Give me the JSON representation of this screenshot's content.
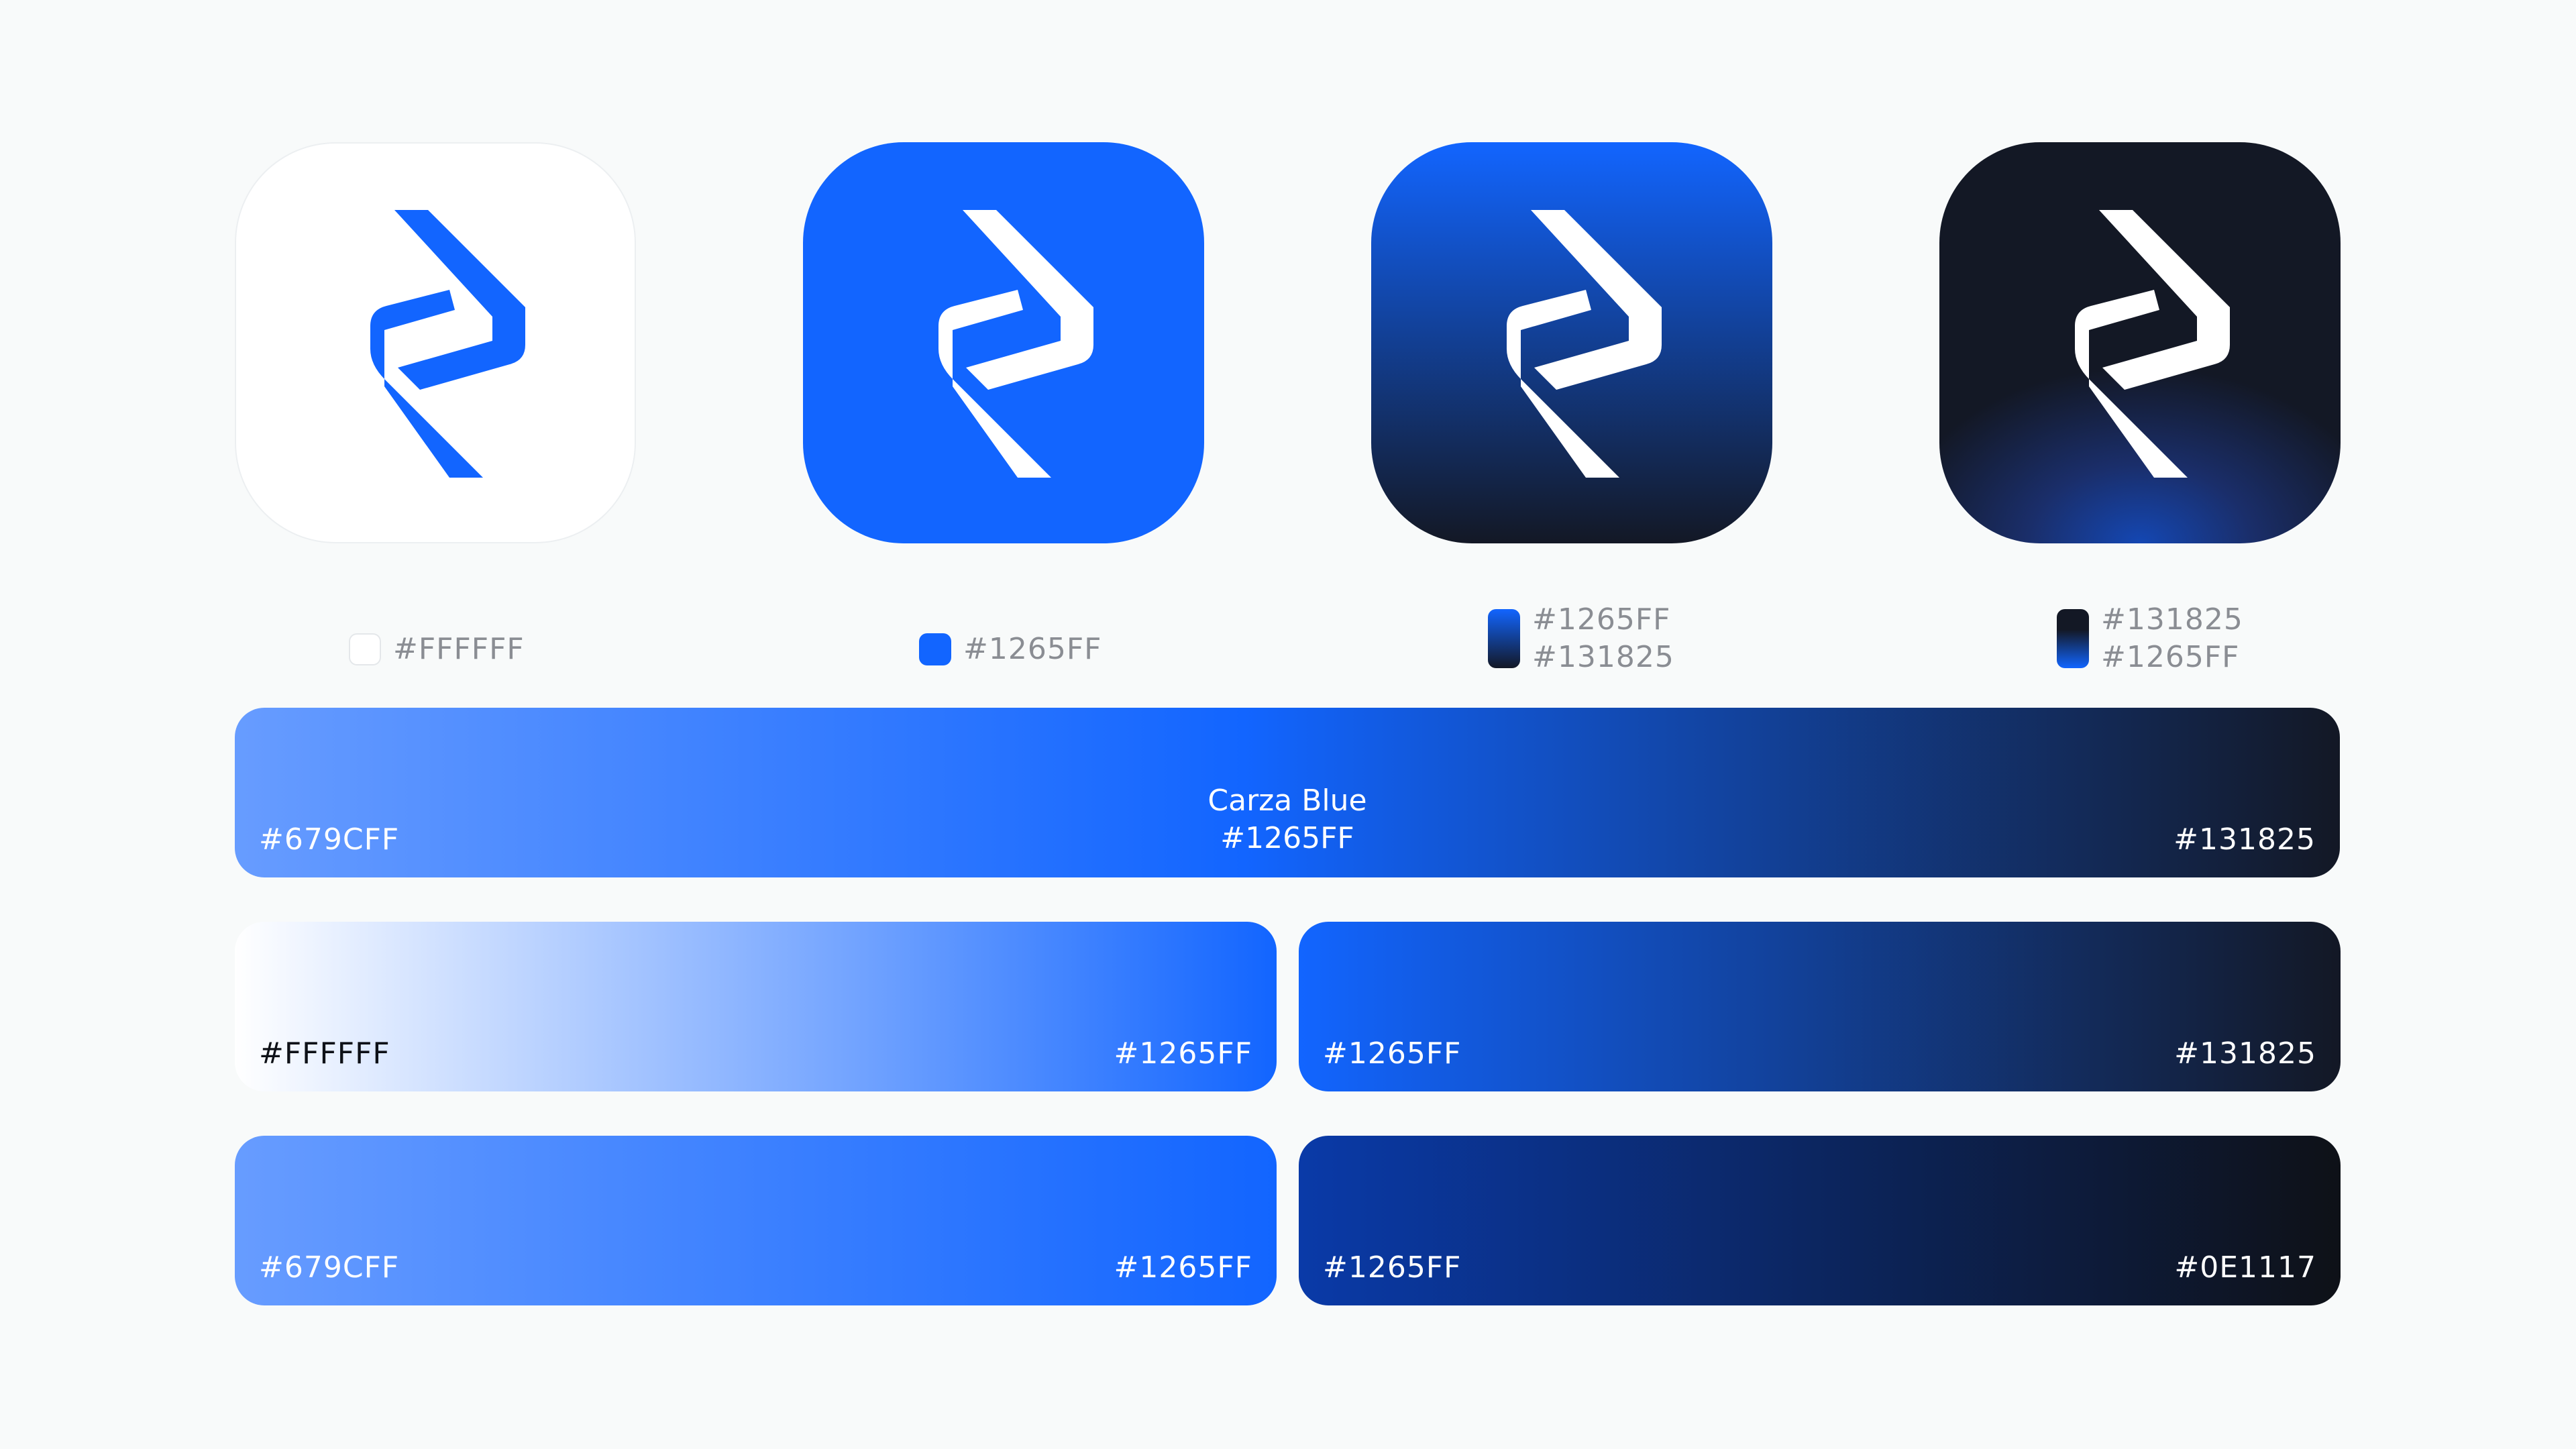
{
  "icons": [
    {
      "variant": "white",
      "background": "#FFFFFF",
      "mark_color": "#1265FF"
    },
    {
      "variant": "blue",
      "background": "#1265FF",
      "mark_color": "#FFFFFF"
    },
    {
      "variant": "blue-gradient",
      "background": "#1265FF",
      "mark_color": "#FFFFFF"
    },
    {
      "variant": "dark",
      "background": "#131825",
      "mark_color": "#FFFFFF"
    }
  ],
  "legends": [
    {
      "codes": [
        "#FFFFFF"
      ]
    },
    {
      "codes": [
        "#1265FF"
      ]
    },
    {
      "codes": [
        "#1265FF",
        "#131825"
      ]
    },
    {
      "codes": [
        "#131825",
        "#1265FF"
      ]
    }
  ],
  "gradients": {
    "main": {
      "left": "#679CFF",
      "center_name": "Carza Blue",
      "center_code": "#1265FF",
      "right": "#131825"
    },
    "a": {
      "left": "#FFFFFF",
      "right": "#1265FF"
    },
    "b": {
      "left": "#1265FF",
      "right": "#131825"
    },
    "c": {
      "left": "#679CFF",
      "right": "#1265FF"
    },
    "d": {
      "left": "#1265FF",
      "right": "#0E1117"
    }
  }
}
